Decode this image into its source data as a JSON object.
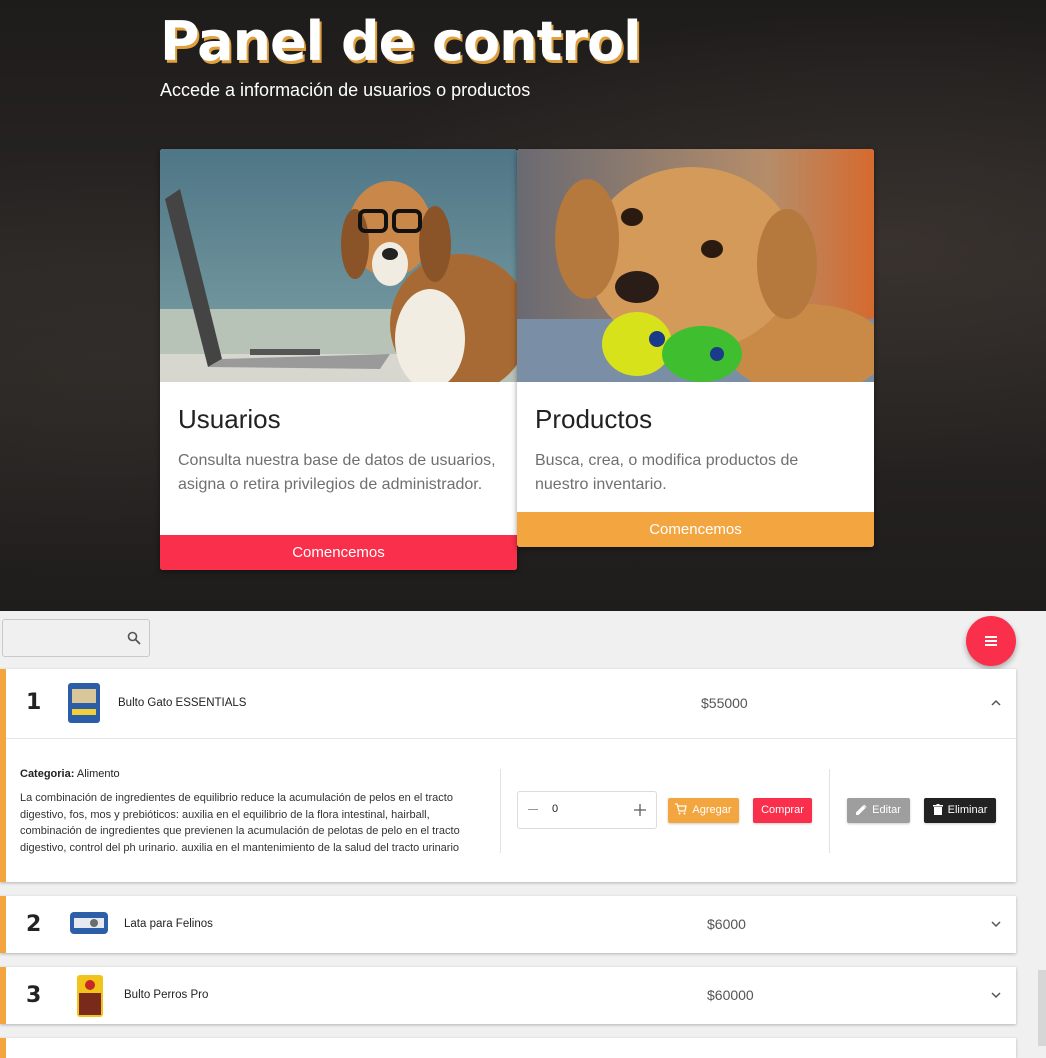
{
  "hero": {
    "title": "Panel de control",
    "subtitle": "Accede a información de usuarios o productos"
  },
  "cards": [
    {
      "title": "Usuarios",
      "text": "Consulta nuestra base de datos de usuarios, asigna o retira privilegios de administrador.",
      "button": "Comencemos",
      "image": "beagle-with-glasses-laptop",
      "button_color": "#f92f4b"
    },
    {
      "title": "Productos",
      "text": "Busca, crea, o modifica productos de nuestro inventario.",
      "button": "Comencemos",
      "image": "puppy-with-toy",
      "button_color": "#f3a640"
    }
  ],
  "search": {
    "placeholder": "",
    "icon": "search-icon"
  },
  "fab": {
    "icon": "menu-icon",
    "color": "#f92f4b"
  },
  "products": [
    {
      "num": "1",
      "name": "Bulto Gato ESSENTIALS",
      "price": "$55000",
      "expanded": true,
      "category_label": "Categoria:",
      "category": "Alimento",
      "description": "La combinación de ingredientes de equilibrio reduce la acumulación de pelos en el tracto digestivo, fos, mos y prebióticos: auxilia en el equilibrio de la flora intestinal, hairball, combinación de ingredientes que previenen la acumulación de pelotas de pelo en el tracto digestivo, control del ph urinario. auxilia en el mantenimiento de la salud del tracto urinario",
      "quantity": "0",
      "buttons": {
        "add": "Agregar",
        "buy": "Comprar",
        "edit": "Editar",
        "delete": "Eliminar"
      }
    },
    {
      "num": "2",
      "name": "Lata para Felinos",
      "price": "$6000",
      "expanded": false
    },
    {
      "num": "3",
      "name": "Bulto Perros Pro",
      "price": "$60000",
      "expanded": false
    }
  ],
  "colors": {
    "accent_red": "#f92f4b",
    "accent_orange": "#f3a640",
    "dark": "#222222"
  }
}
